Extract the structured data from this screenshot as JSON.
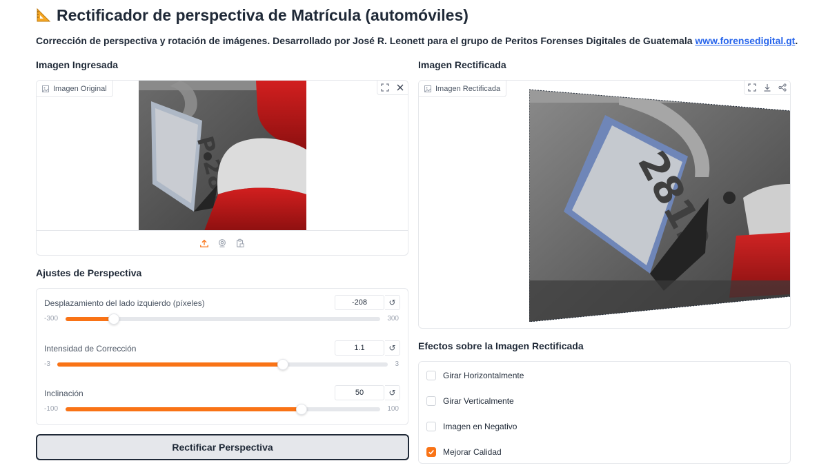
{
  "header": {
    "icon": "triangular-ruler-icon",
    "title": "Rectificador de perspectiva de Matrícula (automóviles)",
    "description": "Corrección de perspectiva y rotación de imágenes. Desarrollado por José R. Leonett para el grupo de Peritos Forenses Digitales de Guatemala",
    "link_text": "www.forensedigital.gt",
    "description_suffix": "."
  },
  "input_section": {
    "label": "Imagen Ingresada",
    "chip_label": "Imagen Original",
    "chip_icon": "image-icon",
    "buttons": [
      "fullscreen-icon",
      "close-icon"
    ],
    "upload_icons": [
      "upload-icon",
      "webcam-icon",
      "clipboard-icon"
    ]
  },
  "output_section": {
    "label": "Imagen Rectificada",
    "chip_label": "Imagen Rectificada",
    "chip_icon": "image-icon",
    "buttons": [
      "fullscreen-icon",
      "download-icon",
      "share-icon"
    ]
  },
  "settings": {
    "label": "Ajustes de Perspectiva",
    "sliders": [
      {
        "label": "Desplazamiento del lado izquierdo (píxeles)",
        "value": "-208",
        "min": "-300",
        "max": "300",
        "fraction": 0.1533
      },
      {
        "label": "Intensidad de Corrección",
        "value": "1.1",
        "min": "-3",
        "max": "3",
        "fraction": 0.6833
      },
      {
        "label": "Inclinación",
        "value": "50",
        "min": "-100",
        "max": "100",
        "fraction": 0.75
      }
    ],
    "reset_icon": "reset-icon"
  },
  "rectify_button": "Rectificar Perspectiva",
  "effects": {
    "label": "Efectos sobre la Imagen Rectificada",
    "options": [
      {
        "label": "Girar Horizontalmente",
        "checked": false
      },
      {
        "label": "Girar Verticalmente",
        "checked": false
      },
      {
        "label": "Imagen en Negativo",
        "checked": false
      },
      {
        "label": "Mejorar Calidad",
        "checked": true
      }
    ]
  },
  "colors": {
    "accent": "#f97316",
    "link": "#2563eb",
    "text": "#1f2937",
    "border": "#e5e7eb"
  }
}
